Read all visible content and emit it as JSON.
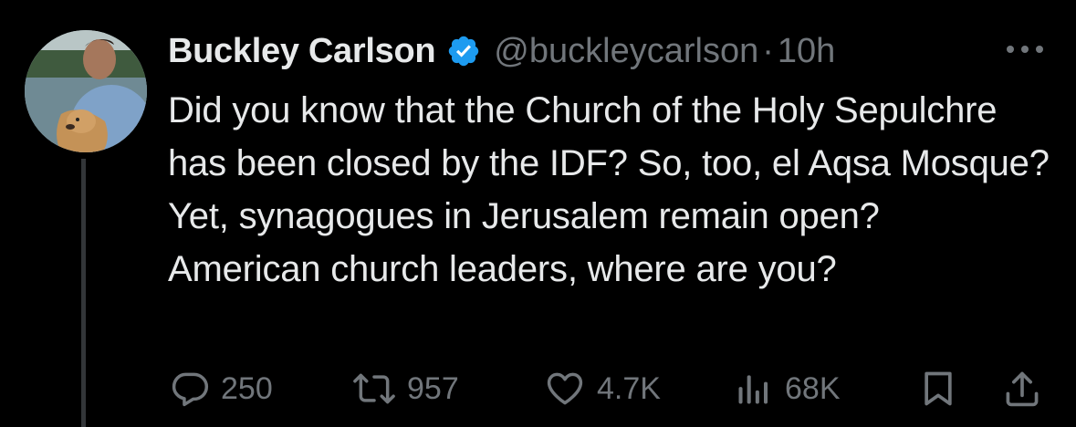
{
  "author": {
    "display_name": "Buckley Carlson",
    "handle": "@buckleycarlson",
    "separator": "·",
    "time": "10h",
    "verified": true
  },
  "tweet": {
    "lines": [
      "Did you know that the Church of the Holy Sepulchre has been closed by the IDF? So, too, el Aqsa Mosque? Yet, synagogues in Jerusalem remain open?",
      "American church leaders, where are you?"
    ]
  },
  "actions": {
    "replies": "250",
    "retweets": "957",
    "likes": "4.7K",
    "views": "68K"
  },
  "icons": {
    "verified": "verified-badge-icon",
    "more": "more-dots-icon",
    "reply": "reply-bubble-icon",
    "retweet": "retweet-icon",
    "like": "heart-icon",
    "views": "views-bar-chart-icon",
    "bookmark": "bookmark-icon",
    "share": "share-icon"
  },
  "colors": {
    "background": "#000000",
    "text": "#e7e9ea",
    "muted": "#71767b",
    "verified": "#1d9bf0",
    "thread_line": "#333639"
  }
}
